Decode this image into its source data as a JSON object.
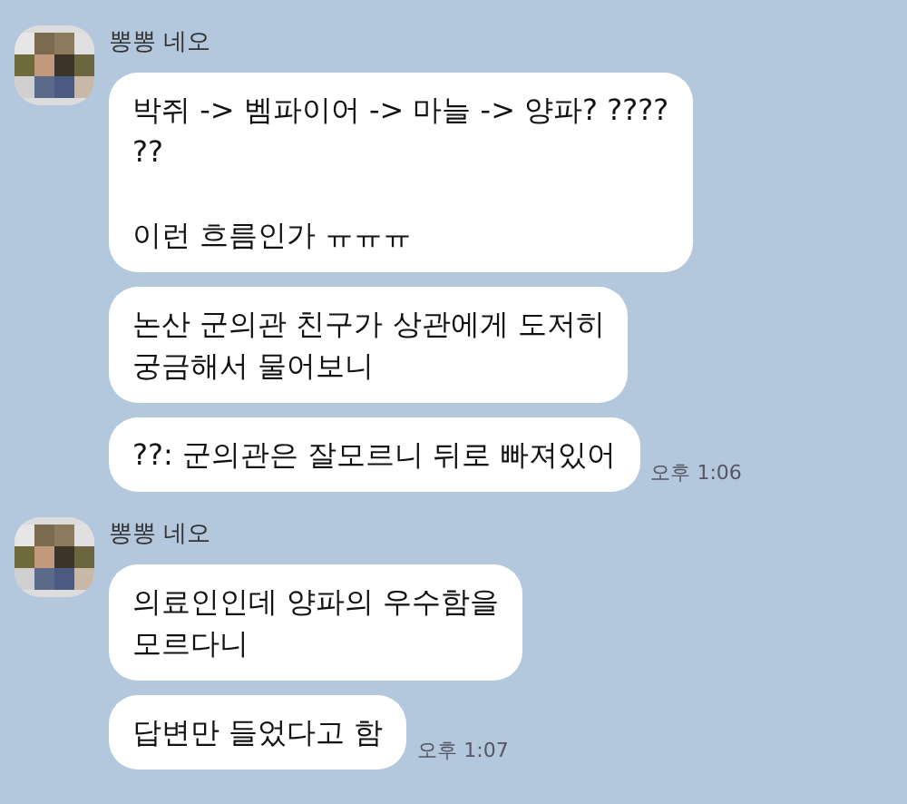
{
  "groups": [
    {
      "sender": "뽕뽕 네오",
      "avatar": {
        "kind": "picture"
      },
      "messages": [
        {
          "text": "박쥐 -> 벰파이어 -> 마늘 -> 양파? ????\n??\n\n이런 흐름인가 ㅠㅠㅠ"
        },
        {
          "text": "논산 군의관 친구가 상관에게 도저히\n궁금해서 물어보니"
        },
        {
          "text": "??: 군의관은 잘모르니 뒤로 빠져있어",
          "time": "오후 1:06"
        }
      ]
    },
    {
      "sender": "뽕뽕 네오",
      "avatar": {
        "kind": "picture"
      },
      "messages": [
        {
          "text": "의료인인데 양파의 우수함을\n모르다니"
        },
        {
          "text": "답변만 들었다고 함",
          "time": "오후 1:07"
        }
      ]
    }
  ]
}
